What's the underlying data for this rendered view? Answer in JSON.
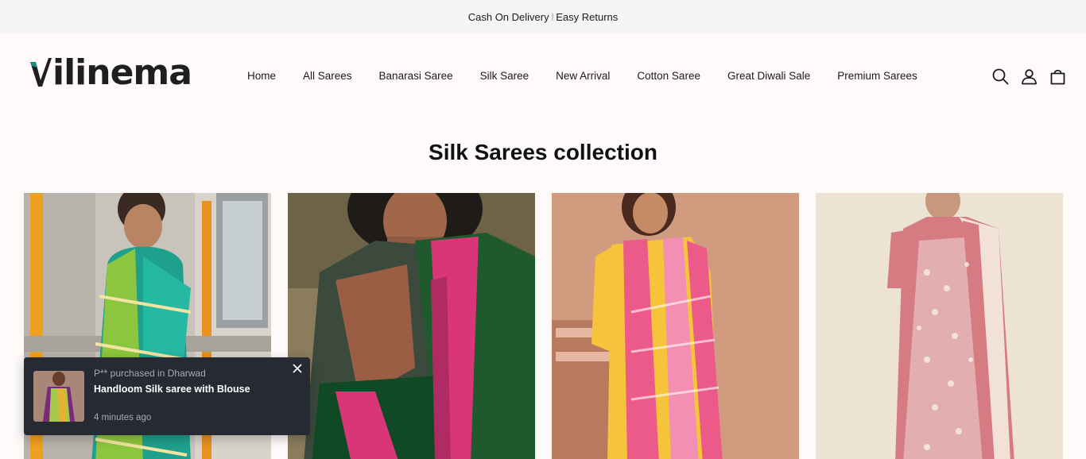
{
  "announcement": {
    "left": "Cash On Delivery",
    "separator": "|",
    "right": "Easy Returns"
  },
  "brand": {
    "name": "ilinema",
    "logo_icon": "v-logo-icon"
  },
  "nav": {
    "items": [
      {
        "label": "Home"
      },
      {
        "label": "All Sarees"
      },
      {
        "label": "Banarasi Saree"
      },
      {
        "label": "Silk Saree"
      },
      {
        "label": "New Arrival"
      },
      {
        "label": "Cotton Saree"
      },
      {
        "label": "Great Diwali Sale"
      },
      {
        "label": "Premium Sarees"
      }
    ]
  },
  "header_icons": [
    "search-icon",
    "account-icon",
    "cart-icon"
  ],
  "collection": {
    "title": "Silk Sarees collection"
  },
  "products": [
    {
      "image": "teal-green-silk-saree"
    },
    {
      "image": "bottle-green-pink-silk-saree"
    },
    {
      "image": "pink-yellow-striped-saree"
    },
    {
      "image": "pink-embroidered-saree"
    }
  ],
  "toast": {
    "meta": "P** purchased in Dharwad",
    "product": "Handloom Silk saree with Blouse",
    "time": "4 minutes ago"
  },
  "colors": {
    "toast_bg": "#262a33",
    "logo_accent": "#1d8f7d",
    "announce_bg": "#f5f5f4"
  }
}
